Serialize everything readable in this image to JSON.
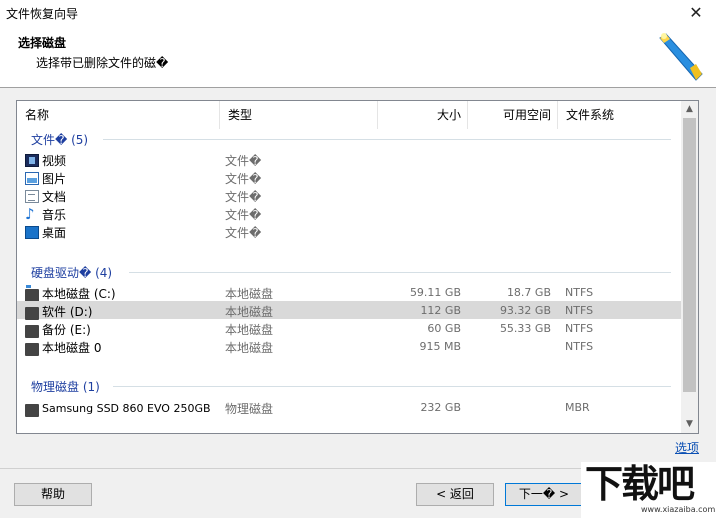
{
  "window": {
    "title": "文件恢复向导",
    "close_glyph": "✕"
  },
  "header": {
    "title": "选择磁盘",
    "subtitle": "选择带已删除文件的磁�"
  },
  "columns": {
    "name": "名称",
    "type": "类型",
    "size": "大小",
    "free": "可用空间",
    "fs": "文件系统"
  },
  "groups": {
    "files": {
      "label": "文件� (5)",
      "items": [
        {
          "name": "视频",
          "type": "文件�",
          "icon": "video-icon"
        },
        {
          "name": "图片",
          "type": "文件�",
          "icon": "picture-icon"
        },
        {
          "name": "文档",
          "type": "文件�",
          "icon": "document-icon"
        },
        {
          "name": "音乐",
          "type": "文件�",
          "icon": "music-icon"
        },
        {
          "name": "桌面",
          "type": "文件�",
          "icon": "desktop-icon"
        }
      ]
    },
    "drives": {
      "label": "硬盘驱动� (4)",
      "items": [
        {
          "name": "本地磁盘 (C:)",
          "type": "本地磁盘",
          "size": "59.11 GB",
          "free": "18.7 GB",
          "fs": "NTFS",
          "selected": false
        },
        {
          "name": "软件 (D:)",
          "type": "本地磁盘",
          "size": "112 GB",
          "free": "93.32 GB",
          "fs": "NTFS",
          "selected": true
        },
        {
          "name": "备份 (E:)",
          "type": "本地磁盘",
          "size": "60 GB",
          "free": "55.33 GB",
          "fs": "NTFS",
          "selected": false
        },
        {
          "name": "本地磁盘 0",
          "type": "本地磁盘",
          "size": "915 MB",
          "free": "",
          "fs": "NTFS",
          "selected": false
        }
      ]
    },
    "physical": {
      "label": "物理磁盘 (1)",
      "items": [
        {
          "name": "Samsung SSD 860 EVO 250GB",
          "type": "物理磁盘",
          "size": "232 GB",
          "free": "",
          "fs": "MBR"
        }
      ]
    }
  },
  "links": {
    "options": "选项"
  },
  "buttons": {
    "help": "帮助",
    "back": "< 返回",
    "next": "下一� >"
  },
  "watermark": {
    "big": "下载吧",
    "small": "www.xiazaiba.com"
  }
}
